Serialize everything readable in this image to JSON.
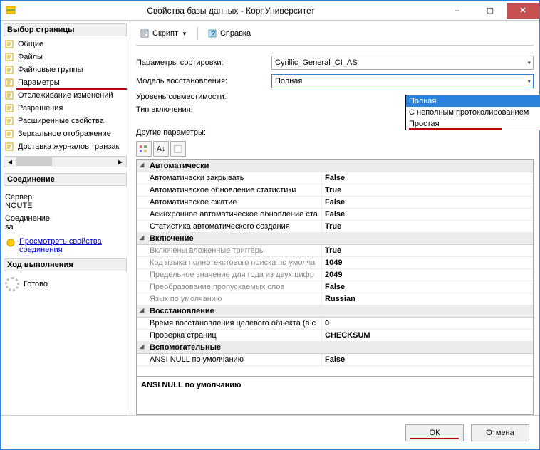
{
  "window": {
    "title": "Свойства базы данных - КорпУниверситет",
    "minimize": "–",
    "maximize": "▢",
    "close": "✕"
  },
  "left": {
    "page_selector": "Выбор страницы",
    "items": [
      "Общие",
      "Файлы",
      "Файловые группы",
      "Параметры",
      "Отслеживание изменений",
      "Разрешения",
      "Расширенные свойства",
      "Зеркальное отображение",
      "Доставка журналов транзак"
    ],
    "connection_header": "Соединение",
    "server_label": "Сервер:",
    "server_value": "NOUTE",
    "conn_label": "Соединение:",
    "conn_value": "sa",
    "view_conn_link": "Просмотреть свойства соединения",
    "progress_header": "Ход выполнения",
    "progress_status": "Готово"
  },
  "toolbar": {
    "script": "Скрипт",
    "help": "Справка"
  },
  "form": {
    "collation_label": "Параметры сортировки:",
    "collation_value": "Cyrillic_General_CI_AS",
    "recovery_label": "Модель восстановления:",
    "recovery_value": "Полная",
    "compat_label": "Уровень совместимости:",
    "containment_label": "Тип включения:",
    "other_label": "Другие параметры:",
    "dropdown_options": [
      "Полная",
      "С неполным протоколированием",
      "Простая"
    ]
  },
  "grid": {
    "categories": [
      {
        "name": "Автоматически",
        "rows": [
          {
            "k": "Автоматически закрывать",
            "v": "False"
          },
          {
            "k": "Автоматическое обновление статистики",
            "v": "True"
          },
          {
            "k": "Автоматическое сжатие",
            "v": "False"
          },
          {
            "k": "Асинхронное автоматическое обновление ста",
            "v": "False"
          },
          {
            "k": "Статистика автоматического создания",
            "v": "True"
          }
        ]
      },
      {
        "name": "Включение",
        "dim": true,
        "rows": [
          {
            "k": "Включены вложенные триггеры",
            "v": "True"
          },
          {
            "k": "Код языка полнотекстового поиска по умолча",
            "v": "1049"
          },
          {
            "k": "Предельное значение для года из двух цифр",
            "v": "2049"
          },
          {
            "k": "Преобразование пропускаемых слов",
            "v": "False"
          },
          {
            "k": "Язык по умолчанию",
            "v": "Russian"
          }
        ]
      },
      {
        "name": "Восстановление",
        "rows": [
          {
            "k": "Время восстановления целевого объекта (в с",
            "v": "0"
          },
          {
            "k": "Проверка страниц",
            "v": "CHECKSUM"
          }
        ]
      },
      {
        "name": "Вспомогательные",
        "rows": [
          {
            "k": "ANSI NULL по умолчанию",
            "v": "False"
          }
        ]
      }
    ],
    "desc": "ANSI NULL по умолчанию"
  },
  "footer": {
    "ok": "ОК",
    "cancel": "Отмена"
  }
}
